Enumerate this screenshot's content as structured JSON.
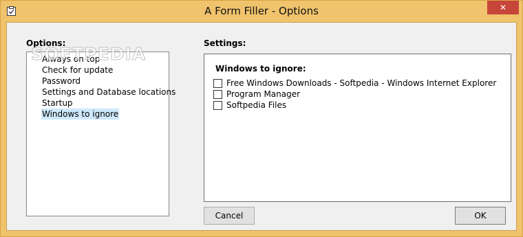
{
  "window": {
    "title": "A Form Filler  - Options",
    "close_glyph": "✕",
    "frame_color": "#f0c36d",
    "close_color": "#c7463a"
  },
  "options": {
    "label": "Options:",
    "items": [
      {
        "label": "Always on top",
        "selected": false
      },
      {
        "label": "Check for update",
        "selected": false
      },
      {
        "label": "Password",
        "selected": false
      },
      {
        "label": "Settings and Database locations",
        "selected": false
      },
      {
        "label": "Startup",
        "selected": false
      },
      {
        "label": "Windows to ignore",
        "selected": true
      }
    ],
    "selection_color": "#cde8fb"
  },
  "settings": {
    "label": "Settings:",
    "heading": "Windows to ignore:",
    "checkboxes": [
      {
        "label": "Free Windows Downloads - Softpedia - Windows Internet Explorer",
        "checked": false
      },
      {
        "label": "Program Manager",
        "checked": false
      },
      {
        "label": "Softpedia Files",
        "checked": false
      }
    ]
  },
  "buttons": {
    "cancel": "Cancel",
    "ok": "OK"
  },
  "watermark": "SOFTPEDIA"
}
